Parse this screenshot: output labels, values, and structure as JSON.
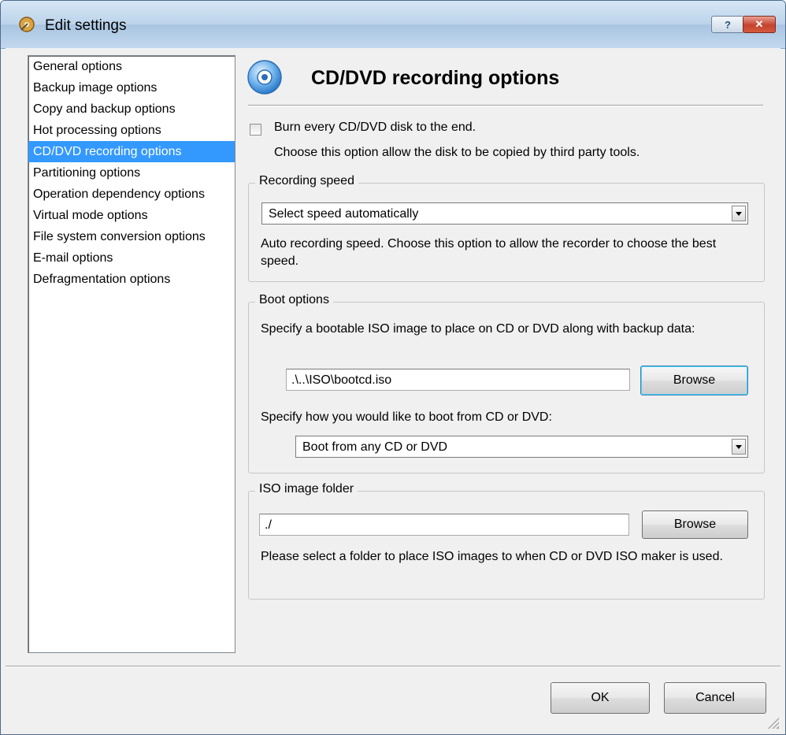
{
  "window": {
    "title": "Edit settings",
    "help_label": "?",
    "close_label": "✕"
  },
  "sidebar": {
    "items": [
      {
        "label": "General options"
      },
      {
        "label": "Backup image options"
      },
      {
        "label": "Copy and backup options"
      },
      {
        "label": "Hot processing options"
      },
      {
        "label": "CD/DVD recording options",
        "selected": true
      },
      {
        "label": "Partitioning options"
      },
      {
        "label": "Operation dependency options"
      },
      {
        "label": "Virtual mode options"
      },
      {
        "label": "File system conversion options"
      },
      {
        "label": "E-mail options"
      },
      {
        "label": "Defragmentation options"
      }
    ]
  },
  "page": {
    "title": "CD/DVD recording options",
    "burn_checkbox": {
      "label": "Burn every CD/DVD disk to the end.",
      "checked": false,
      "hint": "Choose this option allow the disk to be copied by third party tools."
    },
    "recording_speed": {
      "group_label": "Recording speed",
      "selected": "Select speed automatically",
      "description": "Auto recording speed. Choose this option to allow the recorder to choose the best speed."
    },
    "boot_options": {
      "group_label": "Boot options",
      "iso_prompt": "Specify a bootable ISO image to place on CD or DVD along with backup data:",
      "iso_path": ".\\..\\ISO\\bootcd.iso",
      "browse_label": "Browse",
      "boot_prompt": "Specify how you would like to boot from CD or DVD:",
      "boot_selected": "Boot from any CD or DVD"
    },
    "iso_folder": {
      "group_label": "ISO image folder",
      "path": "./",
      "browse_label": "Browse",
      "description": "Please select a folder to place ISO images to when CD or DVD ISO maker is used."
    }
  },
  "footer": {
    "ok_label": "OK",
    "cancel_label": "Cancel"
  },
  "colors": {
    "selection": "#3399ff",
    "title_bar": "#bcd3ea",
    "close_button": "#c4432e"
  }
}
